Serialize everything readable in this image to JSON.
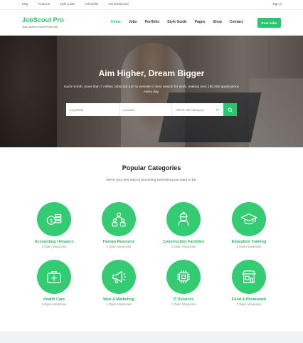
{
  "topbar": {
    "links": [
      "Blog",
      "Products",
      "Style Guide",
      "Full Width",
      "Job Dashboard"
    ],
    "signin": "Sign in"
  },
  "header": {
    "logo": "JobScout Pro",
    "tagline": "Just another WordPress site",
    "nav": [
      "Home",
      "Jobs",
      "Portfolio",
      "Style Guide",
      "Pages",
      "Shop",
      "Contact"
    ],
    "active_nav": "Home",
    "post_button": "Post Jobs"
  },
  "hero": {
    "title": "Aim Higher, Dream Bigger",
    "subtitle": "Each month, more than 7 million Jobscout turn to website in their search for work, making over 180,000 applications every day.",
    "search": {
      "keywords_placeholder": "Keywords",
      "location_placeholder": "Location",
      "category_select": "Select Job Category"
    }
  },
  "categories": {
    "title": "Popular Categories",
    "subtitle": "We're your first step to becoming everything you want to be.",
    "items": [
      {
        "name": "Accounting / Finance",
        "count": "2 Open Vacancies",
        "icon": "money-icon"
      },
      {
        "name": "Human Resource",
        "count": "1 Open Vacancies",
        "icon": "team-icon"
      },
      {
        "name": "Construction Facilities",
        "count": "2 Open Vacancies",
        "icon": "worker-icon"
      },
      {
        "name": "Education Training",
        "count": "1 Open Vacancies",
        "icon": "graduation-cap-icon"
      },
      {
        "name": "Health Care",
        "count": "3 Open Vacancies",
        "icon": "first-aid-kit-icon"
      },
      {
        "name": "Web & Marketing",
        "count": "1 Open Vacancies",
        "icon": "megaphone-icon"
      },
      {
        "name": "IT Services",
        "count": "1 Open Vacancies",
        "icon": "microchip-icon"
      },
      {
        "name": "Food & Restaurant",
        "count": "2 Open Vacancies",
        "icon": "restaurant-icon"
      }
    ]
  },
  "colors": {
    "accent": "#28c76f",
    "icon_bg": "#33cc72"
  }
}
